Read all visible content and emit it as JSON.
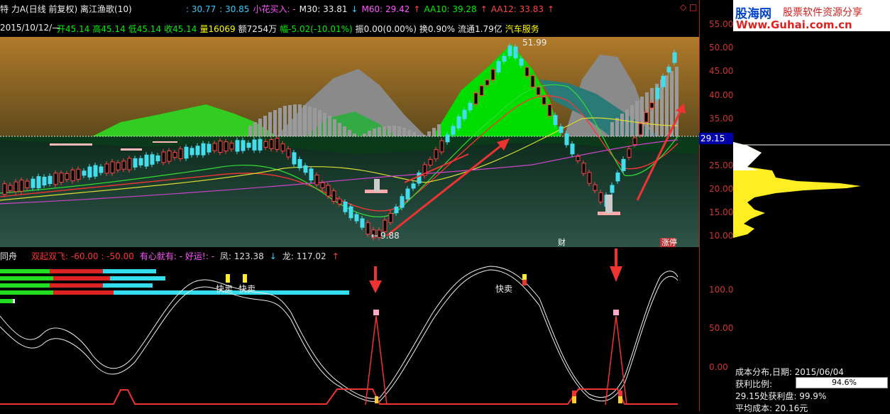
{
  "top": {
    "title": "特 力A(日线 前复权) 离江渔歌(10)",
    "values": [
      {
        "text": ": 30.77",
        "color": "#33ccff"
      },
      {
        "text": ": 30.85",
        "color": "#33ccff"
      },
      {
        "text": "小花买入: -",
        "color": "#ff55ff"
      },
      {
        "text": "M30: 33.81",
        "color": "#eeeeee"
      },
      {
        "text": "↓",
        "color": "#33ccff"
      },
      {
        "text": "M60: 29.42",
        "color": "#ff55ff"
      },
      {
        "text": "↑",
        "color": "#ff4444"
      },
      {
        "text": "AA10: 39.28",
        "color": "#00ee00"
      },
      {
        "text": "↑",
        "color": "#ff4444"
      },
      {
        "text": "AA12: 33.83",
        "color": "#ff4444"
      },
      {
        "text": "↑",
        "color": "#ff4444"
      }
    ],
    "corner_icons": "◇ □"
  },
  "info": {
    "date": "2015/10/12/—",
    "items": [
      {
        "text": "开45.14",
        "color": "#00ee00"
      },
      {
        "text": "高45.14",
        "color": "#00ee00"
      },
      {
        "text": "低45.14",
        "color": "#00ee00"
      },
      {
        "text": "收45.14",
        "color": "#00ee00"
      },
      {
        "text": "量16069",
        "color": "#ffff00"
      },
      {
        "text": "额7254万",
        "color": "#eeeeee"
      },
      {
        "text": "幅-5.02(-10.01%)",
        "color": "#00ee00"
      },
      {
        "text": "振0.00(0.00%)",
        "color": "#eeeeee"
      },
      {
        "text": "换0.90%",
        "color": "#eeeeee"
      },
      {
        "text": "流通1.79亿",
        "color": "#eeeeee"
      },
      {
        "text": "汽车服务",
        "color": "#ffff00"
      }
    ]
  },
  "main_chart": {
    "high_label": "51.99",
    "low_label": "9.88",
    "current_price": "29.15",
    "markers": [
      "财",
      "涨停"
    ],
    "y_ticks": [
      "55.00",
      "50.00",
      "45.00",
      "40.00",
      "35.00",
      "30.00",
      "25.00",
      "20.00",
      "15.00",
      "10.00"
    ]
  },
  "sub_chart": {
    "name": "同舟",
    "items": [
      {
        "text": "双起双飞: -60.00 : -50.00",
        "color": "#ff3333"
      },
      {
        "text": "有心就有: - 好运!: -",
        "color": "#ff55ff"
      },
      {
        "text": "凤: 123.38",
        "color": "#dddddd"
      },
      {
        "text": "↓",
        "color": "#33ccff"
      },
      {
        "text": "龙: 117.02",
        "color": "#dddddd"
      },
      {
        "text": "↑",
        "color": "#ff4444"
      }
    ],
    "sell_labels": [
      "快卖",
      "快卖",
      "快卖"
    ],
    "y_ticks": [
      "100.00",
      "50.00",
      "0.00"
    ]
  },
  "watermark": {
    "logo": "股海网",
    "slogan": "股票软件资源分享",
    "url": "Www.Guhai.com.cn"
  },
  "cost": {
    "title": "成本分布,日期: 2015/06/04",
    "profit_label": "获利比例:",
    "profit_value": "94.6%",
    "profit_fraction": 0.946,
    "line2": "29.15处获利盘: 99.9%",
    "line3": "平均成本: 20.16元"
  }
}
